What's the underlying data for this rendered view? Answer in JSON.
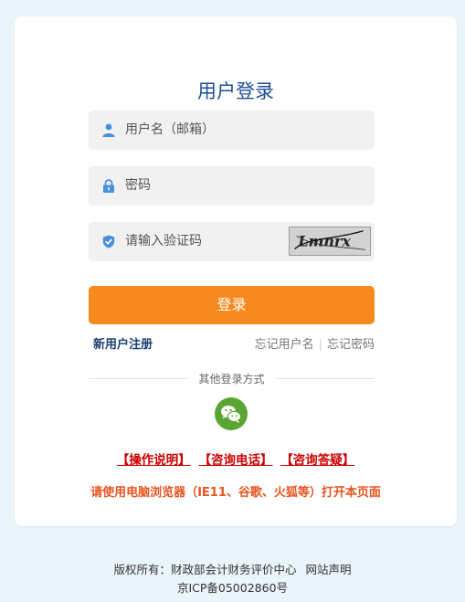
{
  "login": {
    "title": "用户登录",
    "username_placeholder": "用户名（邮箱）",
    "password_placeholder": "密码",
    "captcha_placeholder": "请输入验证码",
    "captcha_text": "Lmnrx",
    "login_button": "登录",
    "register_link": "新用户注册",
    "forgot_username": "忘记用户名",
    "forgot_separator": "|",
    "forgot_password": "忘记密码",
    "other_login": "其他登录方式",
    "link_manual": "【操作说明】",
    "link_phone": "【咨询电话】",
    "link_faq": "【咨询答疑】",
    "browser_notice": "请使用电脑浏览器（IE11、谷歌、火狐等）打开本页面"
  },
  "footer": {
    "copyright": "版权所有：财政部会计财务评价中心",
    "statement": "网站声明",
    "icp": "京ICP备05002860号"
  },
  "colors": {
    "title": "#1c4f93",
    "login_button": "#f68a1f",
    "wechat": "#5ba532",
    "links": "#cc0000",
    "notice": "#e8541f",
    "background": "#eaf4fb"
  }
}
